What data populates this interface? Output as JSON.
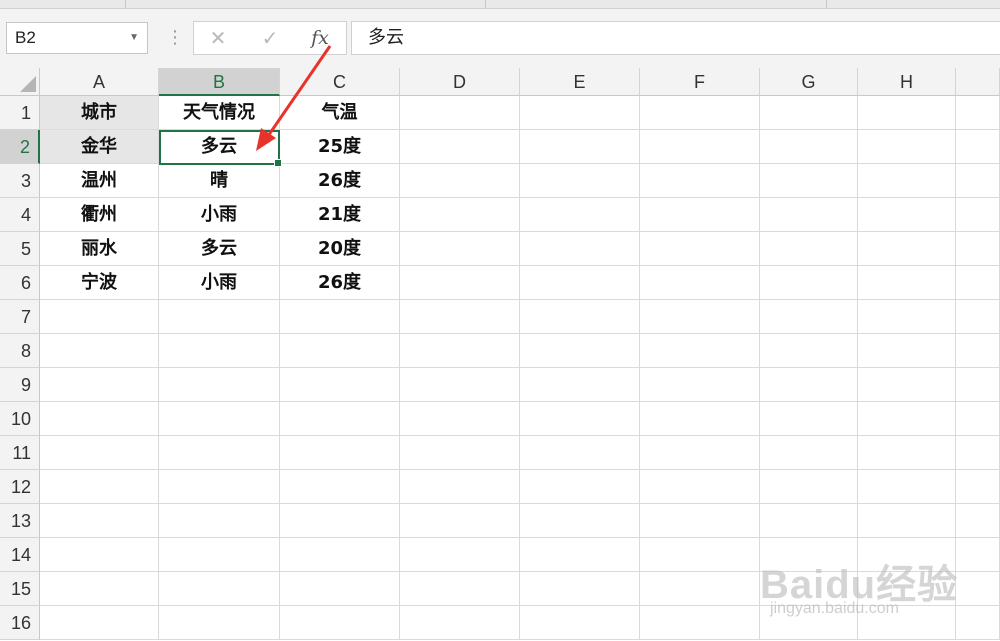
{
  "formula_bar": {
    "name_box": "B2",
    "cancel_icon": "✕",
    "enter_icon": "✓",
    "function_icon": "fx",
    "content": "多云"
  },
  "columns": [
    "A",
    "B",
    "C",
    "D",
    "E",
    "F",
    "G",
    "H"
  ],
  "rows": [
    "1",
    "2",
    "3",
    "4",
    "5",
    "6",
    "7",
    "8",
    "9",
    "10",
    "11",
    "12",
    "13",
    "14",
    "15",
    "16"
  ],
  "cells": {
    "A1": "城市",
    "B1": "天气情况",
    "C1": "气温",
    "A2": "金华",
    "B2": "多云",
    "C2": "25度",
    "A3": "温州",
    "B3": "晴",
    "C3": "26度",
    "A4": "衢州",
    "B4": "小雨",
    "C4": "21度",
    "A5": "丽水",
    "B5": "多云",
    "C5": "20度",
    "A6": "宁波",
    "B6": "小雨",
    "C6": "26度"
  },
  "selected_cell": "B2",
  "watermark": {
    "brand": "Baidu经验",
    "url": "jingyan.baidu.com"
  },
  "colors": {
    "accent": "#217346",
    "arrow": "#e8322a"
  }
}
